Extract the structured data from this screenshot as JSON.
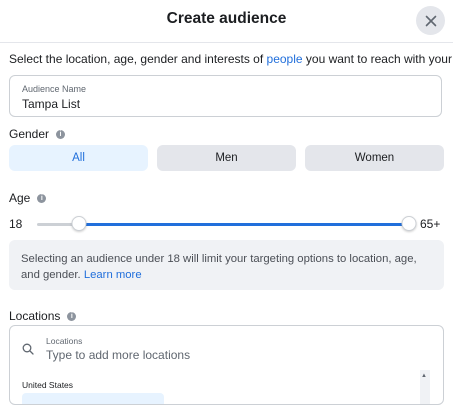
{
  "header": {
    "title": "Create audience",
    "close_icon": "close-icon"
  },
  "intro": {
    "before": "Select the location, age, gender and interests of ",
    "link": "people",
    "after": " you want to reach with your ad."
  },
  "audience_name": {
    "label": "Audience Name",
    "value": "Tampa List"
  },
  "gender": {
    "label": "Gender",
    "options": [
      "All",
      "Men",
      "Women"
    ],
    "selected": "All"
  },
  "age": {
    "label": "Age",
    "min_label": "18",
    "max_label": "65+",
    "range_fraction": [
      0.112,
      1.0
    ]
  },
  "notice": {
    "text": "Selecting an audience under 18 will limit your targeting options to location, age, and gender. ",
    "link": "Learn more"
  },
  "locations": {
    "label": "Locations",
    "field_label": "Locations",
    "placeholder": "Type to add more locations",
    "country": "United States"
  },
  "colors": {
    "accent": "#216fdb",
    "selected_bg": "#e7f3ff",
    "neutral_bg": "#e4e6eb"
  }
}
